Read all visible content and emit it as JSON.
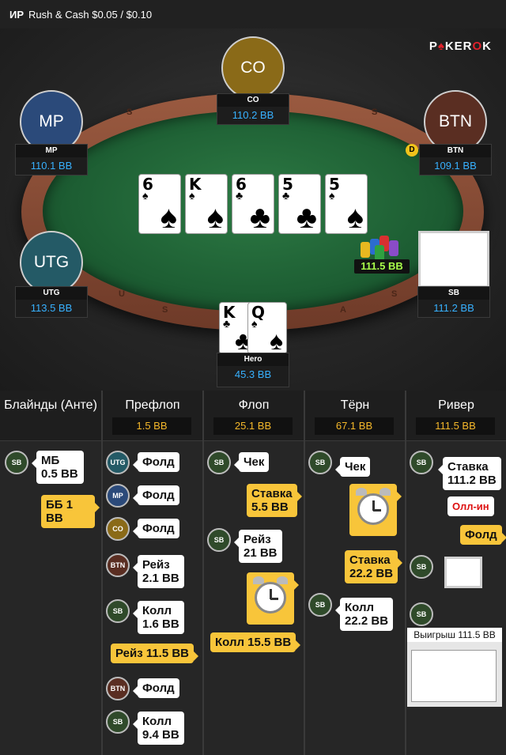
{
  "header": {
    "game_type": "ИР",
    "title": "Rush & Cash $0.05 / $0.10"
  },
  "logo": {
    "text": "POKEROK"
  },
  "rail_text": [
    "S",
    "S",
    "U",
    "S",
    "A",
    "S"
  ],
  "seats": {
    "co": {
      "label": "CO",
      "name": "CO",
      "stack": "110.2 BB",
      "color": "#8a6a18"
    },
    "mp": {
      "label": "MP",
      "name": "MP",
      "stack": "110.1 BB",
      "color": "#2b4a7a"
    },
    "btn": {
      "label": "BTN",
      "name": "BTN",
      "stack": "109.1 BB",
      "color": "#5a2e22"
    },
    "utg": {
      "label": "UTG",
      "name": "UTG",
      "stack": "113.5 BB",
      "color": "#245a66"
    },
    "sb": {
      "name": "SB",
      "stack": "111.2 BB"
    },
    "hero": {
      "name": "Hero",
      "stack": "45.3 BB"
    }
  },
  "dealer_button": "D",
  "board": [
    {
      "rank": "6",
      "suit": "♠"
    },
    {
      "rank": "K",
      "suit": "♠"
    },
    {
      "rank": "6",
      "suit": "♣"
    },
    {
      "rank": "5",
      "suit": "♣"
    },
    {
      "rank": "5",
      "suit": "♠"
    }
  ],
  "hero_cards": [
    {
      "rank": "K",
      "suit": "♣"
    },
    {
      "rank": "Q",
      "suit": "♠"
    }
  ],
  "pot": "111.5 BB",
  "history": {
    "columns": [
      {
        "title": "Блайнды (Анте)",
        "pot": ""
      },
      {
        "title": "Префлоп",
        "pot": "1.5 BB"
      },
      {
        "title": "Флоп",
        "pot": "25.1 BB"
      },
      {
        "title": "Тёрн",
        "pot": "67.1 BB"
      },
      {
        "title": "Ривер",
        "pot": "111.5 BB"
      }
    ],
    "blinds": {
      "pos": "SB",
      "sb_action": "МБ\n0.5 BB",
      "bb_action": "ББ 1 BB"
    },
    "preflop": [
      {
        "pos": "UTG",
        "action": "Фолд"
      },
      {
        "pos": "MP",
        "action": "Фолд"
      },
      {
        "pos": "CO",
        "action": "Фолд"
      },
      {
        "pos": "BTN",
        "action": "Рейз\n2.1 BB"
      },
      {
        "pos": "SB",
        "action": "Колл\n1.6 BB"
      },
      {
        "pos": "",
        "action": "Рейз 11.5 BB"
      },
      {
        "pos": "BTN",
        "action": "Фолд"
      },
      {
        "pos": "SB",
        "action": "Колл\n9.4 BB"
      }
    ],
    "flop": [
      {
        "pos": "SB",
        "action": "Чек"
      },
      {
        "pos": "",
        "action": "Ставка\n5.5 BB"
      },
      {
        "pos": "SB",
        "action": "Рейз\n21 BB"
      },
      {
        "pos": "",
        "action": "Колл 15.5 BB"
      }
    ],
    "turn": [
      {
        "pos": "SB",
        "action": "Чек"
      },
      {
        "pos": "",
        "action": "Ставка\n22.2 BB"
      },
      {
        "pos": "SB",
        "action": "Колл\n22.2 BB"
      }
    ],
    "river": [
      {
        "pos": "SB",
        "action": "Ставка\n111.2 BB"
      },
      {
        "pos": "",
        "action": "Олл-ин"
      },
      {
        "pos": "",
        "action": "Фолд"
      },
      {
        "pos": "SB",
        "action": ""
      },
      {
        "pos": "SB",
        "action": ""
      }
    ],
    "winner": "Выигрыш 111.5 BB"
  },
  "colors": {
    "stack_blue": "#37b1ff",
    "pot_green": "#a8ff4a",
    "history_pot": "#f5b82a",
    "hero_bubble": "#f8c53a"
  }
}
